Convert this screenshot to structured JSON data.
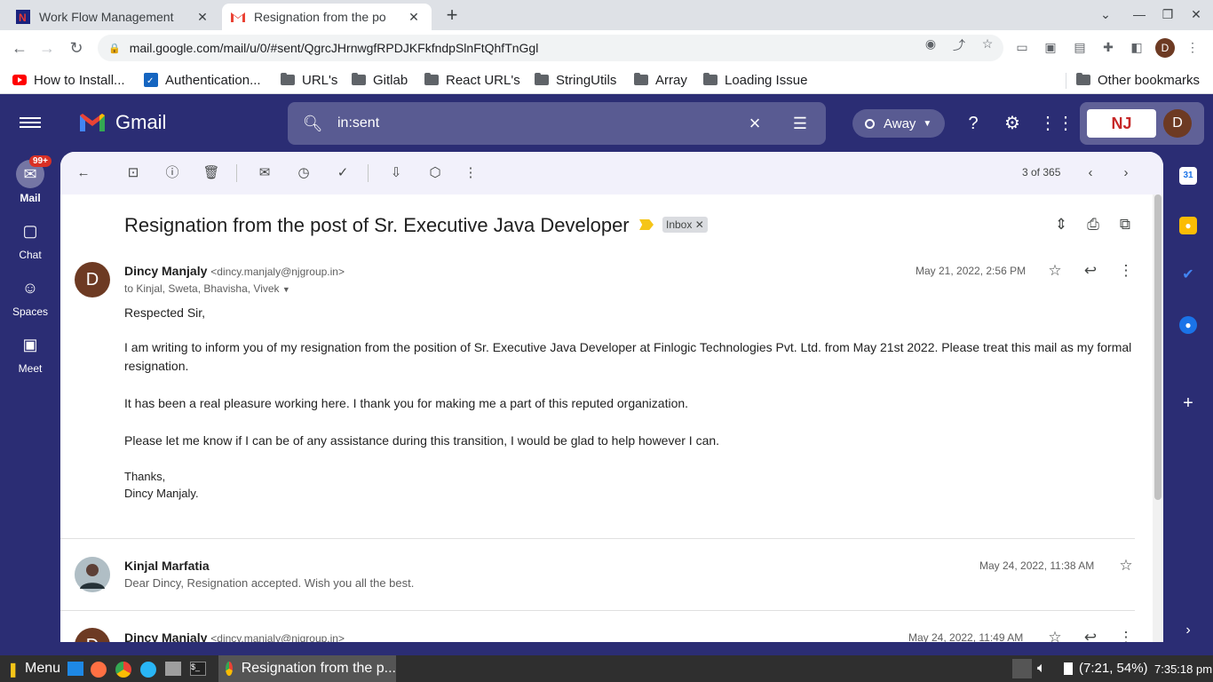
{
  "browser": {
    "tabs": [
      {
        "title": "Work Flow Management",
        "icon": "nj-logo-icon"
      },
      {
        "title": "Resignation from the po",
        "icon": "gmail-icon"
      }
    ],
    "url": "mail.google.com/mail/u/0/#sent/QgrcJHrnwgfRPDJKFkfndpSlnFtQhfTnGgl",
    "profile_initial": "D",
    "bookmarks": [
      "How to Install...",
      "Authentication...",
      "URL's",
      "Gitlab",
      "React URL's",
      "StringUtils",
      "Array",
      "Loading Issue"
    ],
    "other_bookmarks": "Other bookmarks"
  },
  "gmail": {
    "logo_text": "Gmail",
    "search_query": "in:sent",
    "status": "Away",
    "account_initial": "D",
    "org_logo": "NJ",
    "rail": {
      "mail": "Mail",
      "mail_badge": "99+",
      "chat": "Chat",
      "spaces": "Spaces",
      "meet": "Meet"
    },
    "pager": "3 of 365",
    "subject": "Resignation from the post of Sr. Executive Java Developer",
    "label_chip": "Inbox",
    "messages": [
      {
        "initial": "D",
        "sender": "Dincy Manjaly",
        "email": "<dincy.manjaly@njgroup.in>",
        "to": "to Kinjal, Sweta, Bhavisha, Vivek",
        "date": "May 21, 2022, 2:56 PM",
        "body": [
          "Respected Sir,",
          "I am writing to inform you of my resignation from the position of Sr. Executive Java Developer at Finlogic Technologies Pvt. Ltd. from May 21st 2022. Please treat this mail as my formal",
          "resignation.",
          "It has been a real pleasure working here. I thank you for making me a part of this reputed organization.",
          "Please let me know if I can be of any assistance during this transition, I would be glad to help however I can.",
          "Thanks,",
          "Dincy Manjaly."
        ]
      },
      {
        "sender": "Kinjal Marfatia",
        "date": "May 24, 2022, 11:38 AM",
        "snippet": "Dear Dincy, Resignation accepted. Wish you all the best."
      },
      {
        "initial": "D",
        "sender": "Dincy Manjaly",
        "email": "<dincy.manjaly@njgroup.in>",
        "date": "May 24, 2022, 11:49 AM"
      }
    ]
  },
  "taskbar": {
    "menu": "Menu",
    "window_title": "Resignation from the p...",
    "battery": "(7:21, 54%)",
    "clock": "7:35:18 pm"
  },
  "colors": {
    "accent": "#0b57d0",
    "badge": "#d93025",
    "important": "#f5c518"
  }
}
